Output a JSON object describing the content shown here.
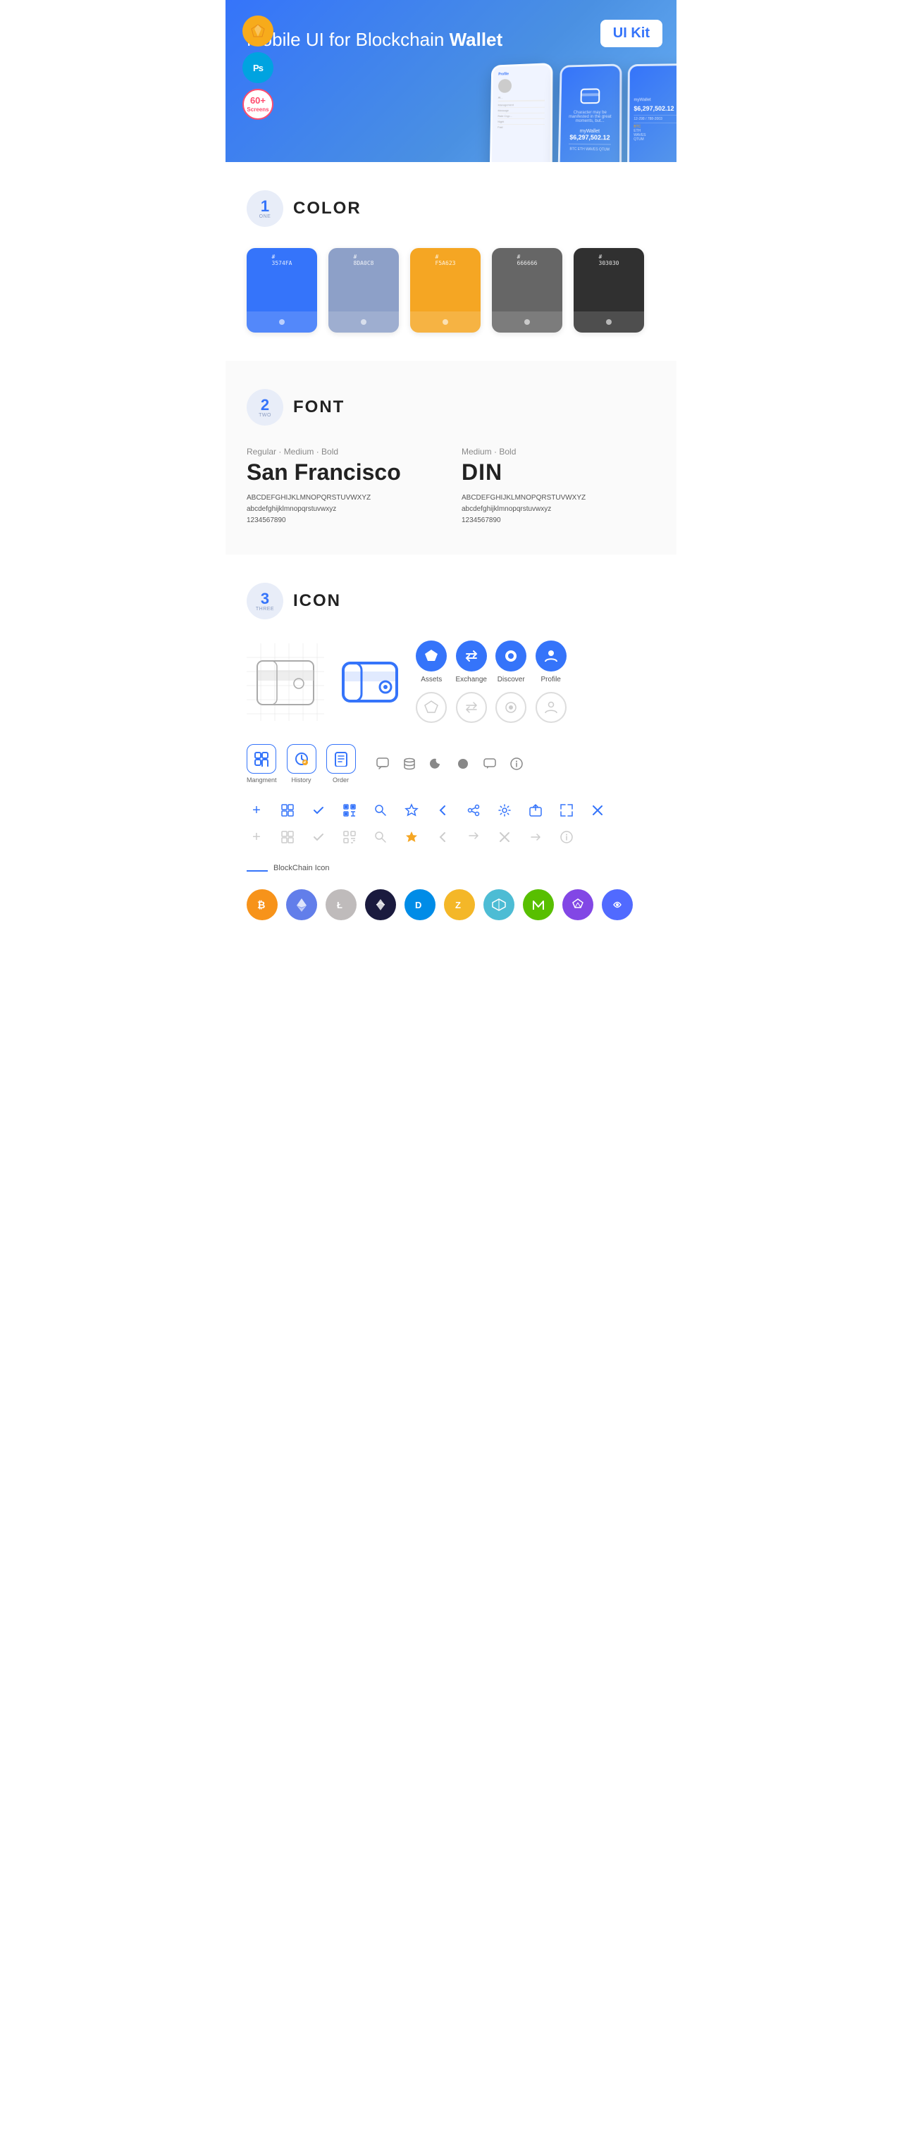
{
  "hero": {
    "title": "Mobile UI for Blockchain ",
    "title_bold": "Wallet",
    "ui_kit_label": "UI Kit",
    "badges": [
      {
        "id": "sketch",
        "label": "S",
        "type": "sketch"
      },
      {
        "id": "ps",
        "label": "Ps",
        "type": "ps"
      },
      {
        "id": "screens",
        "line1": "60+",
        "line2": "Screens",
        "type": "screens"
      }
    ]
  },
  "sections": {
    "color": {
      "number": "1",
      "word": "ONE",
      "title": "COLOR",
      "swatches": [
        {
          "hex": "#3574FA",
          "code": "#3574FA",
          "label": "3574FA"
        },
        {
          "hex": "#8DA0C8",
          "code": "#8DA0C8",
          "label": "8DA0C8"
        },
        {
          "hex": "#F5A623",
          "code": "#F5A623",
          "label": "F5A623"
        },
        {
          "hex": "#666666",
          "code": "#666666",
          "label": "666666"
        },
        {
          "hex": "#303030",
          "code": "#303030",
          "label": "303030"
        }
      ]
    },
    "font": {
      "number": "2",
      "word": "TWO",
      "title": "FONT",
      "fonts": [
        {
          "weights": "Regular · Medium · Bold",
          "name": "San Francisco",
          "uppercase": "ABCDEFGHIJKLMNOPQRSTUVWXYZ",
          "lowercase": "abcdefghijklmnopqrstuvwxyz",
          "numbers": "1234567890"
        },
        {
          "weights": "Medium · Bold",
          "name": "DIN",
          "uppercase": "ABCDEFGHIJKLMNOPQRSTUVWXYZ",
          "lowercase": "abcdefghijklmnopqrstuvwxyz",
          "numbers": "1234567890"
        }
      ]
    },
    "icon": {
      "number": "3",
      "word": "THREE",
      "title": "ICON",
      "nav_icons": [
        {
          "label": "Assets",
          "color": "#3574FA",
          "symbol": "◆"
        },
        {
          "label": "Exchange",
          "color": "#3574FA",
          "symbol": "⇌"
        },
        {
          "label": "Discover",
          "color": "#3574FA",
          "symbol": "●"
        },
        {
          "label": "Profile",
          "color": "#3574FA",
          "symbol": "👤"
        }
      ],
      "app_icons": [
        {
          "label": "Mangment",
          "symbol": "▣"
        },
        {
          "label": "History",
          "symbol": "⏱"
        },
        {
          "label": "Order",
          "symbol": "📋"
        }
      ],
      "small_icons_row1": [
        "+",
        "⊞",
        "✓",
        "⊟",
        "⌕",
        "☆",
        "‹",
        "≺",
        "⚙",
        "⊡",
        "⇌",
        "✕"
      ],
      "small_icons_row2_gray": [
        "+",
        "⊞",
        "✓",
        "⊟",
        "⌕",
        "☆",
        "‹",
        "≺",
        "✗",
        "→",
        "ℹ"
      ],
      "blockchain_label": "BlockChain Icon",
      "crypto_icons": [
        {
          "symbol": "₿",
          "bg": "#F7931A",
          "name": "BTC"
        },
        {
          "symbol": "Ξ",
          "bg": "#627EEA",
          "name": "ETH"
        },
        {
          "symbol": "Ł",
          "bg": "#BFBBBB",
          "name": "LTC"
        },
        {
          "symbol": "✦",
          "bg": "#1A1A2E",
          "name": "DASH"
        },
        {
          "symbol": "D",
          "bg": "#008CE7",
          "name": "DASH2"
        },
        {
          "symbol": "Z",
          "bg": "#F4B728",
          "name": "ZEC"
        },
        {
          "symbol": "◈",
          "bg": "#4FC3F7",
          "name": "IOTA"
        },
        {
          "symbol": "N",
          "bg": "#58BF00",
          "name": "NEO"
        },
        {
          "symbol": "M",
          "bg": "#8247E5",
          "name": "MATIC"
        },
        {
          "symbol": "∞",
          "bg": "#516AFF",
          "name": "BAND"
        }
      ]
    }
  }
}
